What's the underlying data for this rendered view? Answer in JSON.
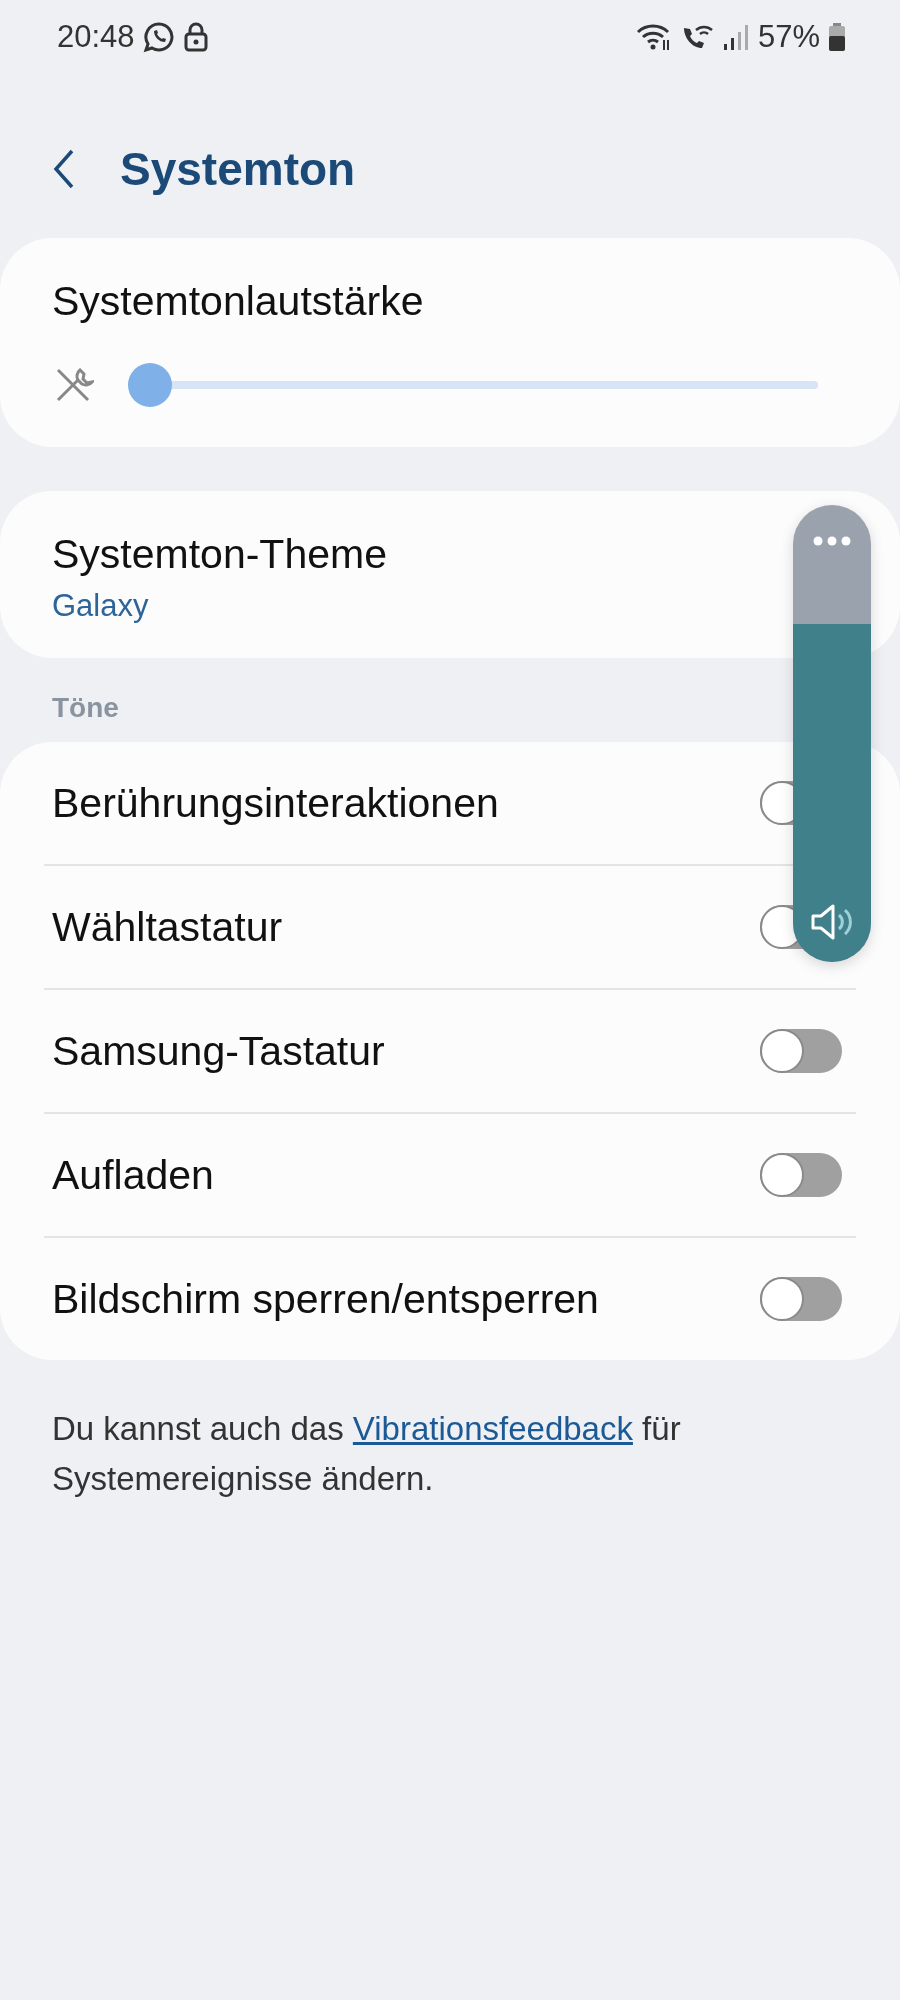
{
  "status_bar": {
    "time": "20:48",
    "battery": "57%"
  },
  "header": {
    "title": "Systemton"
  },
  "volume": {
    "label": "Systemtonlautstärke",
    "level": 0
  },
  "theme": {
    "label": "Systemton-Theme",
    "value": "Galaxy"
  },
  "section": "Töne",
  "toggles": [
    {
      "label": "Berührungsinteraktionen",
      "on": false
    },
    {
      "label": "Wähltastatur",
      "on": false
    },
    {
      "label": "Samsung-Tastatur",
      "on": false
    },
    {
      "label": "Aufladen",
      "on": false
    },
    {
      "label": "Bildschirm sperren/entsperren",
      "on": false
    }
  ],
  "footer": {
    "before": "Du kannst auch das ",
    "link": "Vibrationsfeedback",
    "after": " für Systemereignisse ändern."
  },
  "volume_panel": {
    "level": 0.74
  }
}
